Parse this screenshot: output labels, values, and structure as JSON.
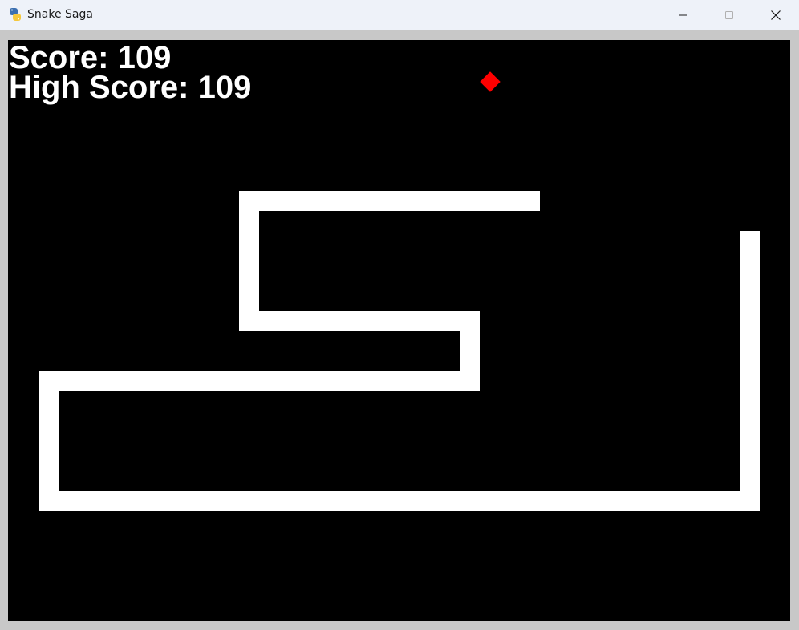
{
  "window": {
    "title": "Snake Saga",
    "app_icon": "python-icon",
    "controls": [
      "minimize-icon",
      "maximize-icon",
      "close-icon"
    ]
  },
  "game": {
    "score_text": "Score: 109",
    "high_score_text": "High Score: 109",
    "score": 109,
    "high_score": 109,
    "colors": {
      "background": "#000000",
      "snake": "#ffffff",
      "food": "#ff0000",
      "text": "#ffffff",
      "frame": "#c8c8c8"
    }
  }
}
